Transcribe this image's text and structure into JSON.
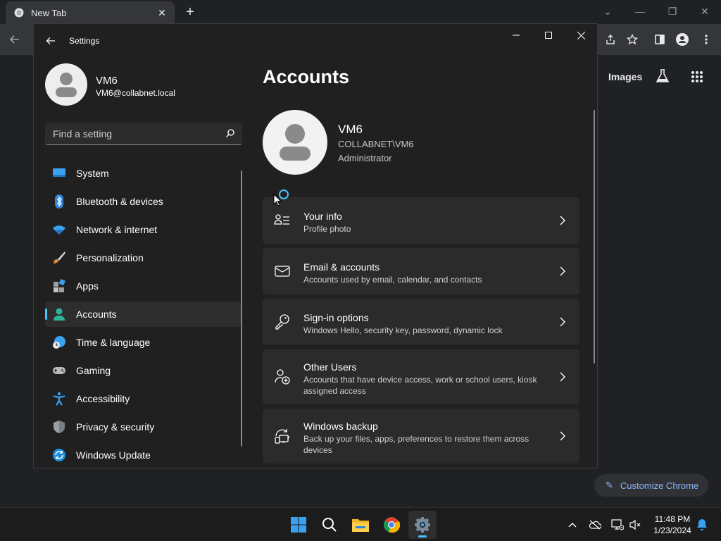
{
  "chrome": {
    "tab_title": "New Tab",
    "images_link": "Images",
    "customize_label": "Customize Chrome"
  },
  "settings": {
    "window_title": "Settings",
    "user": {
      "name": "VM6",
      "email": "VM6@collabnet.local"
    },
    "search_placeholder": "Find a setting",
    "nav": [
      {
        "label": "System",
        "icon": "monitor-icon"
      },
      {
        "label": "Bluetooth & devices",
        "icon": "bluetooth-icon"
      },
      {
        "label": "Network & internet",
        "icon": "wifi-icon"
      },
      {
        "label": "Personalization",
        "icon": "brush-icon"
      },
      {
        "label": "Apps",
        "icon": "apps-icon"
      },
      {
        "label": "Accounts",
        "icon": "person-icon",
        "active": true
      },
      {
        "label": "Time & language",
        "icon": "clock-globe-icon"
      },
      {
        "label": "Gaming",
        "icon": "gamepad-icon"
      },
      {
        "label": "Accessibility",
        "icon": "accessibility-icon"
      },
      {
        "label": "Privacy & security",
        "icon": "shield-icon"
      },
      {
        "label": "Windows Update",
        "icon": "update-icon"
      }
    ],
    "page_title": "Accounts",
    "account": {
      "name": "VM6",
      "domain": "COLLABNET\\VM6",
      "role": "Administrator"
    },
    "cards": [
      {
        "title": "Your info",
        "subtitle": "Profile photo",
        "icon": "user-info-icon"
      },
      {
        "title": "Email & accounts",
        "subtitle": "Accounts used by email, calendar, and contacts",
        "icon": "mail-icon"
      },
      {
        "title": "Sign-in options",
        "subtitle": "Windows Hello, security key, password, dynamic lock",
        "icon": "key-icon"
      },
      {
        "title": "Other Users",
        "subtitle": "Accounts that have device access, work or school users, kiosk assigned access",
        "icon": "add-user-icon"
      },
      {
        "title": "Windows backup",
        "subtitle": "Back up your files, apps, preferences to restore them across devices",
        "icon": "backup-icon"
      }
    ]
  },
  "taskbar": {
    "time": "11:48 PM",
    "date": "1/23/2024",
    "apps": [
      "windows-start-icon",
      "search-icon",
      "file-explorer-icon",
      "chrome-icon",
      "settings-gear-icon"
    ]
  },
  "colors": {
    "accent": "#4cc2ff",
    "window_bg": "#202020",
    "card_bg": "#2b2b2b"
  }
}
